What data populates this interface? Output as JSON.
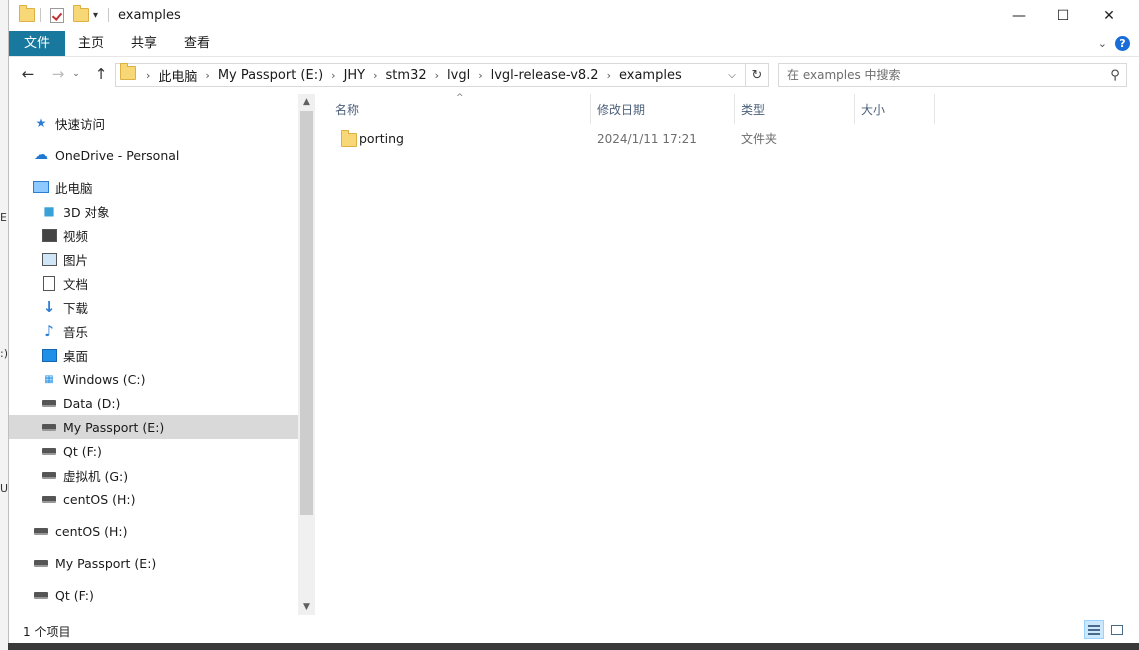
{
  "window": {
    "title": "examples"
  },
  "behind_window": {
    "fragments": [
      "E",
      ":)",
      "U"
    ]
  },
  "window_controls": {
    "minimize": "—",
    "maximize": "☐",
    "close": "✕"
  },
  "ribbon": {
    "tabs": [
      "文件",
      "主页",
      "共享",
      "查看"
    ],
    "expand_icon": "chevron-down-icon",
    "help_label": "?"
  },
  "address": {
    "crumbs": [
      "此电脑",
      "My Passport (E:)",
      "JHY",
      "stm32",
      "lvgl",
      "lvgl-release-v8.2",
      "examples"
    ],
    "separator": "›"
  },
  "search": {
    "placeholder": "在 examples 中搜索"
  },
  "nav_pane": {
    "quick_access": "快速访问",
    "onedrive": "OneDrive - Personal",
    "this_pc": "此电脑",
    "pc_items": [
      "3D 对象",
      "视频",
      "图片",
      "文档",
      "下载",
      "音乐",
      "桌面",
      "Windows (C:)",
      "Data (D:)",
      "My Passport (E:)",
      "Qt (F:)",
      "虚拟机 (G:)",
      "centOS (H:)"
    ],
    "removable": [
      "centOS (H:)",
      "My Passport (E:)",
      "Qt (F:)"
    ],
    "selected_item": "My Passport (E:)"
  },
  "columns": {
    "name": "名称",
    "modified": "修改日期",
    "type": "类型",
    "size": "大小"
  },
  "files": [
    {
      "name": "porting",
      "modified": "2024/1/11 17:21",
      "type": "文件夹",
      "size": ""
    }
  ],
  "status_bar": {
    "count_text": "1 个项目"
  },
  "colors": {
    "file_tab": "#19789e",
    "selection": "#d9d9d9",
    "folder": "#f8d776",
    "help": "#1a6dd8"
  }
}
